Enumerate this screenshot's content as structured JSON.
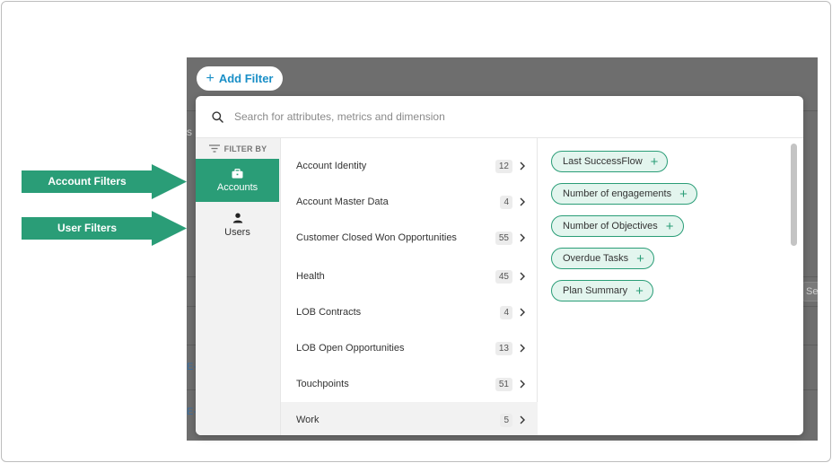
{
  "add_filter": {
    "label": "Add Filter"
  },
  "search": {
    "placeholder": "Search for attributes, metrics and dimension"
  },
  "filter_by": {
    "label": "FILTER BY",
    "categories": [
      {
        "label": "Accounts",
        "icon": "briefcase-icon",
        "active": true
      },
      {
        "label": "Users",
        "icon": "user-icon",
        "active": false
      }
    ]
  },
  "groups": [
    {
      "label": "Account Identity",
      "count": "12"
    },
    {
      "label": "Account Master Data",
      "count": "4"
    },
    {
      "label": "Customer Closed Won Opportunities",
      "count": "55"
    },
    {
      "label": "Health",
      "count": "45"
    },
    {
      "label": "LOB Contracts",
      "count": "4"
    },
    {
      "label": "LOB Open Opportunities",
      "count": "13"
    },
    {
      "label": "Touchpoints",
      "count": "51"
    },
    {
      "label": "Work",
      "count": "5"
    }
  ],
  "attributes": [
    {
      "label": "Last SuccessFlow"
    },
    {
      "label": "Number of engagements"
    },
    {
      "label": "Number of Objectives"
    },
    {
      "label": "Overdue Tasks"
    },
    {
      "label": "Plan Summary"
    }
  ],
  "annotations": {
    "account_filters": "Account Filters",
    "user_filters": "User Filters"
  },
  "background": {
    "peek_text": "s",
    "search_peek": "Sea",
    "link_1": "E-",
    "link_2": "E-"
  },
  "colors": {
    "accent": "#2a9d77",
    "link": "#1a8fc7",
    "overlay": "#6e6e6e"
  }
}
